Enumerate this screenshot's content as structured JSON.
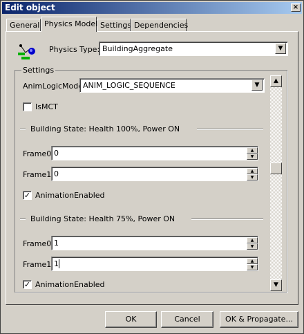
{
  "window": {
    "title": "Edit object",
    "close_glyph": "×"
  },
  "tabs": [
    {
      "label": "General",
      "active": false
    },
    {
      "label": "Physics Model",
      "active": true
    },
    {
      "label": "Settings",
      "active": false
    },
    {
      "label": "Dependencies",
      "active": false
    }
  ],
  "physics": {
    "icon": "physics-model-icon",
    "label": "Physics Type:",
    "value": "BuildingAggregate"
  },
  "settings": {
    "group_label": "Settings",
    "anim_logic_mode": {
      "label": "AnimLogicMode",
      "value": "ANIM_LOGIC_SEQUENCE"
    },
    "is_mct": {
      "label": "IsMCT",
      "checked": false
    },
    "states": [
      {
        "header": "Building State: Health 100%, Power ON",
        "frame0": {
          "label": "Frame0",
          "value": "0"
        },
        "frame1": {
          "label": "Frame1",
          "value": "0"
        },
        "animation": {
          "label": "AnimationEnabled",
          "checked": true
        }
      },
      {
        "header": "Building State: Health 75%, Power ON",
        "frame0": {
          "label": "Frame0",
          "value": "1"
        },
        "frame1": {
          "label": "Frame1",
          "value": "1"
        },
        "animation": {
          "label": "AnimationEnabled",
          "checked": true
        }
      }
    ]
  },
  "buttons": {
    "ok": "OK",
    "cancel": "Cancel",
    "ok_propagate": "OK & Propagate..."
  },
  "glyphs": {
    "dropdown": "▼",
    "spin_up": "▲",
    "spin_down": "▼",
    "scroll_up": "▲",
    "scroll_down": "▼",
    "check": "✓"
  }
}
